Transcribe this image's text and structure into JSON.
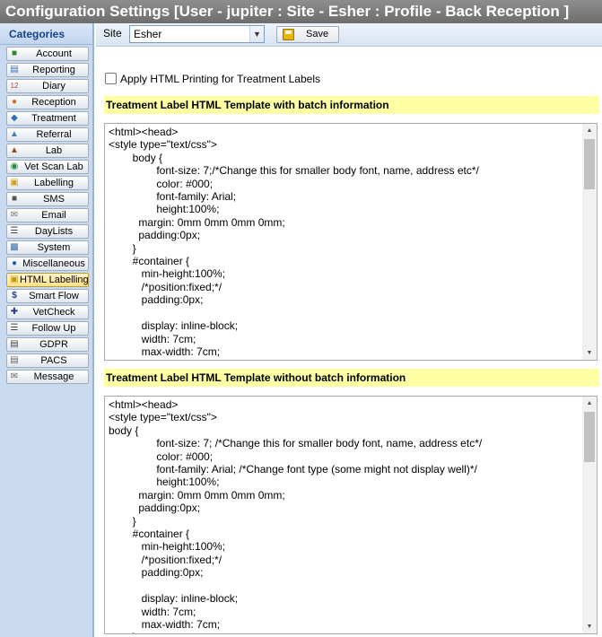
{
  "window": {
    "title": "Configuration Settings [User - jupiter : Site - Esher : Profile - Back Reception ]"
  },
  "sidebar": {
    "header": "Categories",
    "items": [
      {
        "label": "Account",
        "icon": "account-icon",
        "active": false
      },
      {
        "label": "Reporting",
        "icon": "reporting-icon",
        "active": false
      },
      {
        "label": "Diary",
        "icon": "diary-icon",
        "active": false
      },
      {
        "label": "Reception",
        "icon": "reception-icon",
        "active": false
      },
      {
        "label": "Treatment",
        "icon": "treatment-icon",
        "active": false
      },
      {
        "label": "Referral",
        "icon": "referral-icon",
        "active": false
      },
      {
        "label": "Lab",
        "icon": "lab-icon",
        "active": false
      },
      {
        "label": "Vet Scan Lab",
        "icon": "vet-scan-lab-icon",
        "active": false
      },
      {
        "label": "Labelling",
        "icon": "labelling-icon",
        "active": false
      },
      {
        "label": "SMS",
        "icon": "sms-icon",
        "active": false
      },
      {
        "label": "Email",
        "icon": "email-icon",
        "active": false
      },
      {
        "label": "DayLists",
        "icon": "daylists-icon",
        "active": false
      },
      {
        "label": "System",
        "icon": "system-icon",
        "active": false
      },
      {
        "label": "Miscellaneous",
        "icon": "miscellaneous-icon",
        "active": false
      },
      {
        "label": "HTML Labelling",
        "icon": "html-labelling-icon",
        "active": true
      },
      {
        "label": "Smart Flow",
        "icon": "smart-flow-icon",
        "active": false
      },
      {
        "label": "VetCheck",
        "icon": "vetcheck-icon",
        "active": false
      },
      {
        "label": "Follow Up",
        "icon": "follow-up-icon",
        "active": false
      },
      {
        "label": "GDPR",
        "icon": "gdpr-icon",
        "active": false
      },
      {
        "label": "PACS",
        "icon": "pacs-icon",
        "active": false
      },
      {
        "label": "Message",
        "icon": "message-icon",
        "active": false
      }
    ]
  },
  "toolbar": {
    "site_label": "Site",
    "site_value": "Esher",
    "save_label": "Save"
  },
  "options": {
    "apply_html_printing_label": "Apply HTML Printing for Treatment Labels",
    "apply_html_printing_checked": false
  },
  "sections": [
    {
      "title": "Treatment Label HTML Template with batch information",
      "code": "<html><head>\n<style type=\"text/css\">\n        body {\n                font-size: 7;/*Change this for smaller body font, name, address etc*/\n                color: #000;\n                font-family: Arial;\n                height:100%;\n          margin: 0mm 0mm 0mm 0mm;\n          padding:0px;\n        }\n        #container {\n           min-height:100%;\n           /*position:fixed;*/\n           padding:0px;\n\n           display: inline-block;\n           width: 7cm;\n           max-width: 7cm;\n        }"
    },
    {
      "title": "Treatment Label HTML Template without batch information",
      "code": "<html><head>\n<style type=\"text/css\">\nbody {\n                font-size: 7; /*Change this for smaller body font, name, address etc*/\n                color: #000;\n                font-family: Arial; /*Change font type (some might not display well)*/\n                height:100%;\n          margin: 0mm 0mm 0mm 0mm;\n          padding:0px;\n        }\n        #container {\n           min-height:100%;\n           /*position:fixed;*/\n           padding:0px;\n\n           display: inline-block;\n           width: 7cm;\n           max-width: 7cm;\n        }"
    }
  ]
}
